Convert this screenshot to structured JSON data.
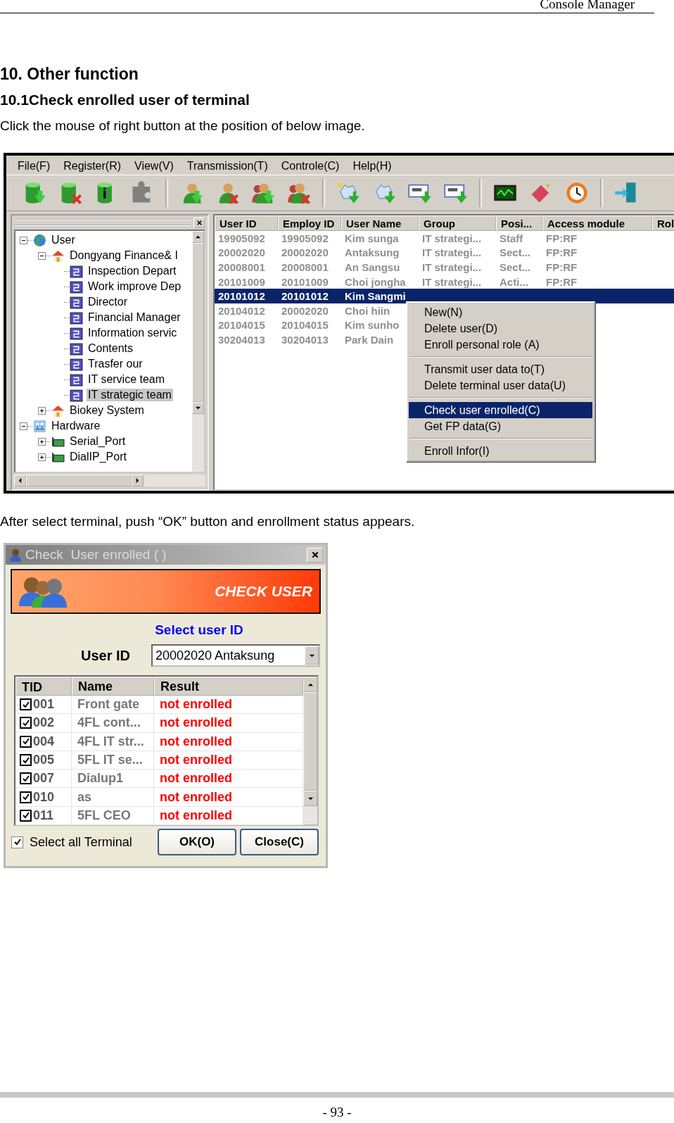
{
  "header": {
    "title": "Console Manager"
  },
  "heading": "10. Other function",
  "subheading": "10.1Check enrolled user of terminal",
  "intro": "Click the mouse of right button at the position of below image.",
  "console_window": {
    "menu": [
      "File(F)",
      "Register(R)",
      "View(V)",
      "Transmission(T)",
      "Controle(C)",
      "Help(H)"
    ],
    "tree": {
      "items": [
        {
          "label": "User",
          "kind": "globe",
          "expanded": true,
          "selected": false,
          "children": [
            {
              "label": "Dongyang Finance& I",
              "kind": "house",
              "expanded": true,
              "selected": false,
              "children": [
                {
                  "label": "Inspection Depart",
                  "kind": "group",
                  "selected": false
                },
                {
                  "label": "Work improve Dep",
                  "kind": "group",
                  "selected": false
                },
                {
                  "label": "Director",
                  "kind": "group",
                  "selected": false
                },
                {
                  "label": "Financial Manager",
                  "kind": "group",
                  "selected": false
                },
                {
                  "label": "Information servic",
                  "kind": "group",
                  "selected": false
                },
                {
                  "label": "Contents",
                  "kind": "group",
                  "selected": false
                },
                {
                  "label": "Trasfer our",
                  "kind": "group",
                  "selected": false
                },
                {
                  "label": "IT service team",
                  "kind": "group",
                  "selected": false
                },
                {
                  "label": "IT strategic team",
                  "kind": "group",
                  "selected": true
                }
              ]
            },
            {
              "label": "Biokey System",
              "kind": "house",
              "expanded": false,
              "selected": false
            }
          ]
        },
        {
          "label": "Hardware",
          "kind": "hardware",
          "expanded": true,
          "selected": false,
          "children": [
            {
              "label": "Serial_Port",
              "kind": "port",
              "expanded": false,
              "selected": false
            },
            {
              "label": "DialIP_Port",
              "kind": "port",
              "expanded": false,
              "selected": false
            }
          ]
        }
      ]
    },
    "table": {
      "columns": [
        "User ID",
        "Employ ID",
        "User Name",
        "Group",
        "Posi...",
        "Access module",
        "Rol"
      ],
      "rows": [
        {
          "cells": [
            "19905092",
            "19905092",
            "Kim sunga",
            "IT strategi...",
            "Staff",
            "FP:RF"
          ],
          "selected": false
        },
        {
          "cells": [
            "20002020",
            "20002020",
            "Antaksung",
            "IT strategi...",
            "Sect...",
            "FP:RF"
          ],
          "selected": false
        },
        {
          "cells": [
            "20008001",
            "20008001",
            "An Sangsu",
            "IT strategi...",
            "Sect...",
            "FP:RF"
          ],
          "selected": false
        },
        {
          "cells": [
            "20101009",
            "20101009",
            "Choi jongha",
            "IT strategi...",
            "Acti...",
            "FP:RF"
          ],
          "selected": false
        },
        {
          "cells": [
            "20101012",
            "20101012",
            "Kim Sangmi"
          ],
          "selected": true
        },
        {
          "cells": [
            "20104012",
            "20002020",
            "Choi hiin"
          ],
          "selected": false
        },
        {
          "cells": [
            "20104015",
            "20104015",
            "Kim sunho"
          ],
          "selected": false
        },
        {
          "cells": [
            "30204013",
            "30204013",
            "Park Dain"
          ],
          "selected": false
        }
      ]
    },
    "context_menu": {
      "groups": [
        [
          {
            "label": "New(N)",
            "selected": false
          },
          {
            "label": "Delete user(D)",
            "selected": false
          },
          {
            "label": "Enroll personal role (A)",
            "selected": false
          }
        ],
        [
          {
            "label": "Transmit user data to(T)",
            "selected": false
          },
          {
            "label": "Delete terminal user data(U)",
            "selected": false
          }
        ],
        [
          {
            "label": "Check user enrolled(C)",
            "selected": true
          },
          {
            "label": "Get FP data(G)",
            "selected": false
          }
        ],
        [
          {
            "label": "Enroll Infor(I)",
            "selected": false
          }
        ]
      ]
    }
  },
  "note": "After select terminal, push “OK” button and enrollment status appears.",
  "dialog": {
    "title": "Check  User enrolled ( )",
    "banner": "CHECK USER",
    "prompt": "Select user ID",
    "user_id_label": "User ID",
    "user_id_value": "20002020 Antaksung",
    "columns": [
      "TID",
      "Name",
      "Result"
    ],
    "rows": [
      {
        "checked": true,
        "tid": "001",
        "name": "Front gate",
        "result": "not enrolled"
      },
      {
        "checked": true,
        "tid": "002",
        "name": "4FL cont...",
        "result": "not enrolled"
      },
      {
        "checked": true,
        "tid": "004",
        "name": "4FL IT str...",
        "result": "not enrolled"
      },
      {
        "checked": true,
        "tid": "005",
        "name": "5FL IT se...",
        "result": "not enrolled"
      },
      {
        "checked": true,
        "tid": "007",
        "name": "Dialup1",
        "result": "not enrolled"
      },
      {
        "checked": true,
        "tid": "010",
        "name": "as",
        "result": "not enrolled"
      },
      {
        "checked": true,
        "tid": "011",
        "name": "5FL CEO",
        "result": "not enrolled"
      }
    ],
    "select_all": {
      "label": "Select all Terminal",
      "checked": true
    },
    "buttons": [
      "OK(O)",
      "Close(C)"
    ]
  },
  "footer": {
    "page": "- 93 -"
  }
}
